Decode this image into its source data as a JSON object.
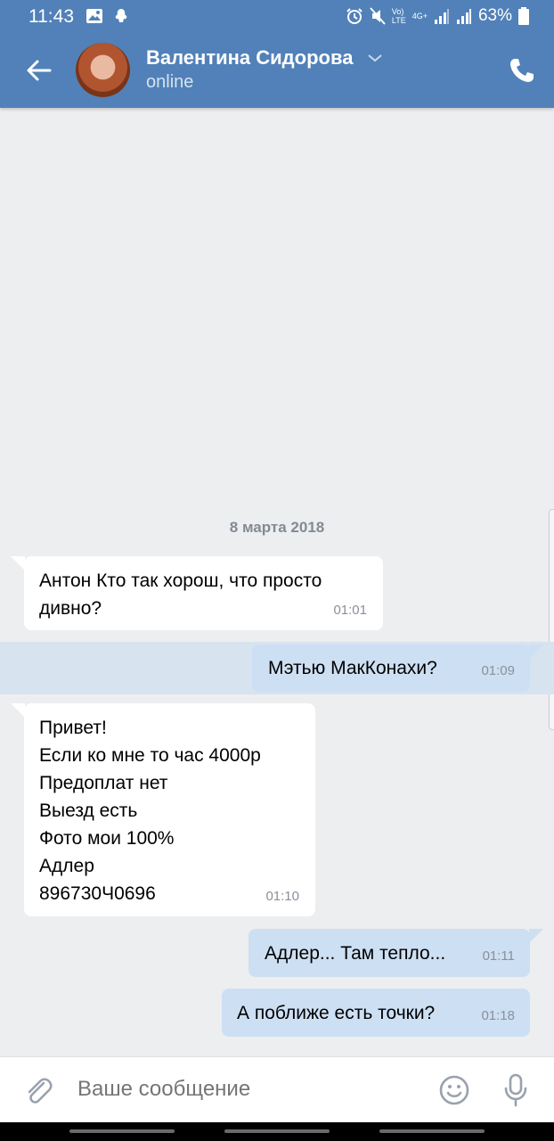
{
  "status_bar": {
    "time": "11:43",
    "battery": "63%",
    "network_top": "Vo)",
    "network_bottom": "LTE",
    "network2_top": "4G+"
  },
  "header": {
    "contact_name": "Валентина Сидорова",
    "contact_status": "online",
    "accent_color": "#5181b8"
  },
  "chat": {
    "date_separator": "8 марта 2018",
    "messages": [
      {
        "direction": "in",
        "text": "Антон Кто так хорош, что просто\nдивно?",
        "time": "01:01"
      },
      {
        "direction": "out",
        "text": "Мэтью МакКонахи?",
        "time": "01:09",
        "highlighted": true
      },
      {
        "direction": "in",
        "text": "Привет!\nЕсли ко мне то час 4000р\nПредоплат нет\nВыезд есть\nФото мои 100%\nАдлер\n896730Ч0696",
        "time": "01:10"
      },
      {
        "direction": "out",
        "text": "Адлер... Там тепло...",
        "time": "01:11"
      },
      {
        "direction": "out",
        "text": "А поближе есть точки?",
        "time": "01:18"
      }
    ]
  },
  "composer": {
    "placeholder": "Ваше сообщение"
  }
}
